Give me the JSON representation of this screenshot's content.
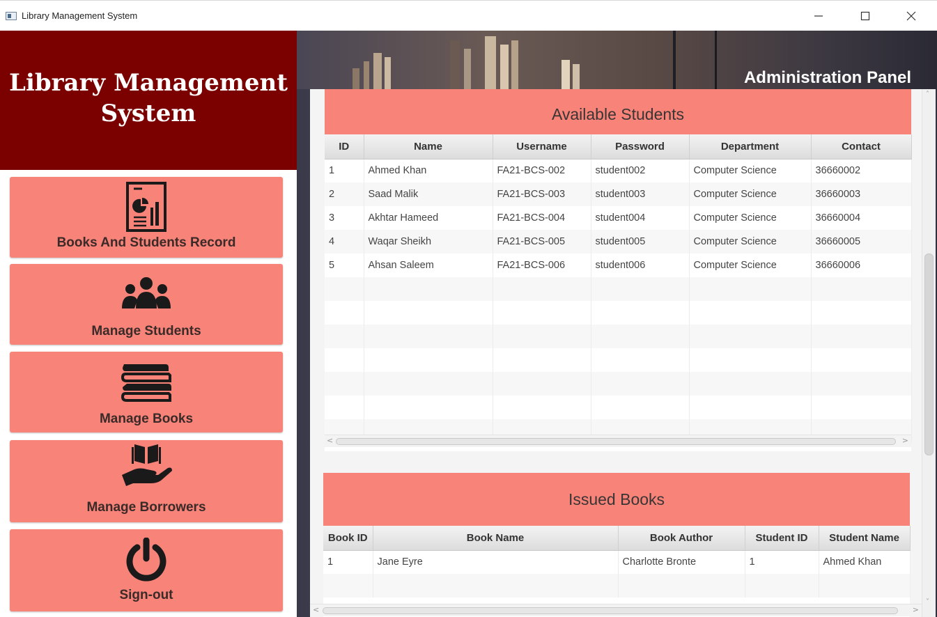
{
  "window": {
    "title": "Library Management System",
    "minimize_glyph": "—",
    "maximize_glyph": "☐",
    "close_glyph": "✕"
  },
  "sidebar": {
    "brand_title_line1": "Library Management",
    "brand_title_line2": "System",
    "items": [
      {
        "label": "Books And Students Record",
        "icon": "report-chart-icon"
      },
      {
        "label": "Manage Students",
        "icon": "users-group-icon"
      },
      {
        "label": "Manage Books",
        "icon": "book-stack-icon"
      },
      {
        "label": "Manage Borrowers",
        "icon": "book-hand-icon"
      },
      {
        "label": "Sign-out",
        "icon": "power-icon"
      }
    ]
  },
  "header": {
    "panel_title": "Administration Panel"
  },
  "students": {
    "title": "Available Students",
    "columns": [
      "ID",
      "Name",
      "Username",
      "Password",
      "Department",
      "Contact"
    ],
    "rows": [
      [
        "1",
        "Ahmed Khan",
        "FA21-BCS-002",
        "student002",
        "Computer Science",
        "36660002"
      ],
      [
        "2",
        "Saad Malik",
        "FA21-BCS-003",
        "student003",
        "Computer Science",
        "36660003"
      ],
      [
        "3",
        "Akhtar Hameed",
        "FA21-BCS-004",
        "student004",
        "Computer Science",
        "36660004"
      ],
      [
        "4",
        "Waqar Sheikh",
        "FA21-BCS-005",
        "student005",
        "Computer Science",
        "36660005"
      ],
      [
        "5",
        "Ahsan Saleem",
        "FA21-BCS-006",
        "student006",
        "Computer Science",
        "36660006"
      ]
    ]
  },
  "issued": {
    "title": "Issued Books",
    "columns": [
      "Book ID",
      "Book Name",
      "Book Author",
      "Student ID",
      "Student Name"
    ],
    "rows": [
      [
        "1",
        "Jane Eyre",
        "Charlotte Bronte",
        "1",
        "Ahmed Khan"
      ]
    ]
  },
  "colors": {
    "brand": "#7b0000",
    "accent": "#f88379"
  }
}
